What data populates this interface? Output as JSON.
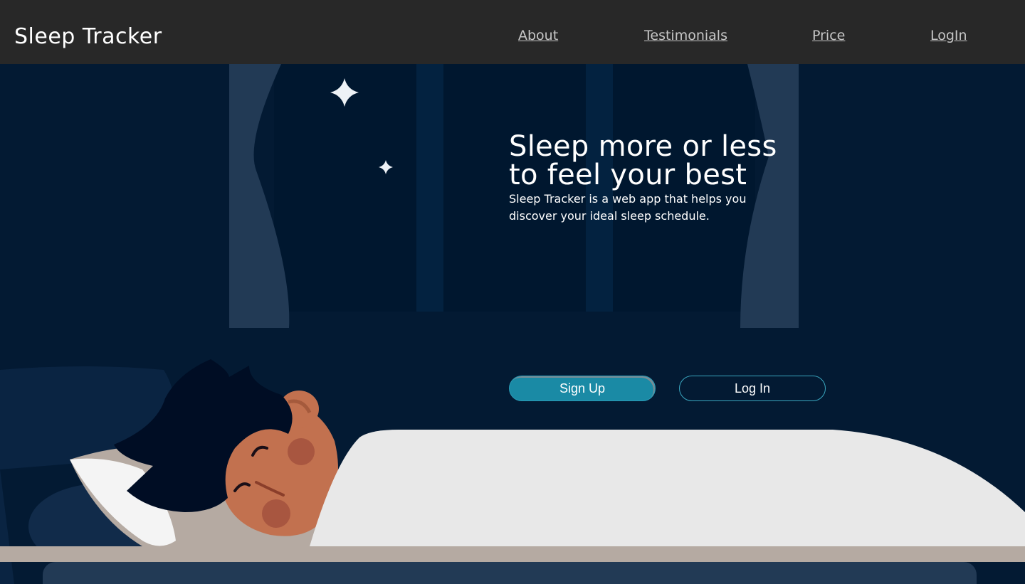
{
  "header": {
    "brand": "Sleep Tracker",
    "nav": [
      {
        "label": "About"
      },
      {
        "label": "Testimonials"
      },
      {
        "label": "Price"
      },
      {
        "label": "LogIn"
      }
    ]
  },
  "hero": {
    "title_line1": "Sleep more or less",
    "title_line2": "to feel your best",
    "subtitle": "Sleep Tracker is a web app that helps you discover your ideal sleep schedule.",
    "signup_label": "Sign Up",
    "login_label": "Log In"
  },
  "colors": {
    "navbar": "#282828",
    "background": "#031a33",
    "accent": "#1a8aa5",
    "sheet": "#e8e8e8"
  }
}
